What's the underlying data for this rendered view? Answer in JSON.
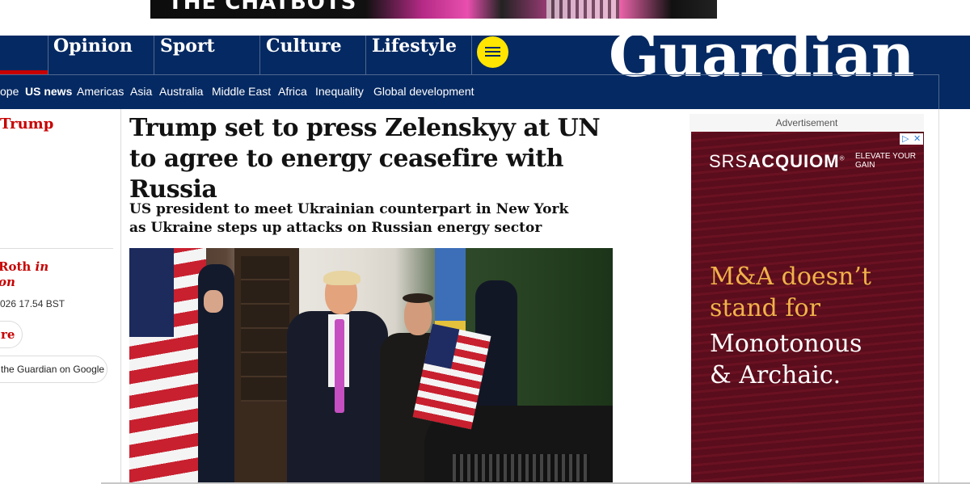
{
  "top_ad": {
    "text": "THE CHATBOTS"
  },
  "nav": {
    "pillars": [
      "Opinion",
      "Sport",
      "Culture",
      "Lifestyle"
    ],
    "logo": "Guardian",
    "subnav": [
      "ope",
      "US news",
      "Americas",
      "Asia",
      "Australia",
      "Middle East",
      "Africa",
      "Inequality",
      "Global development"
    ],
    "active_subnav": "US news"
  },
  "meta": {
    "series": "Trump",
    "byline_name": "Roth",
    "byline_in": "in",
    "byline_location": "on",
    "date": "026 17.54 BST",
    "share_label": "re",
    "google_label": "the Guardian on Google"
  },
  "article": {
    "headline": "Trump set to press Zelenskyy at UN to agree to energy ceasefire with Russia",
    "standfirst": "US president to meet Ukrainian counterpart in New York as Ukraine steps up attacks on Russian energy sector"
  },
  "ad": {
    "label": "Advertisement",
    "brand_prefix": "SRS",
    "brand_name": "ACQUIOM",
    "brand_mark": "®",
    "tagline": "ELEVATE YOUR GAIN",
    "line1": "M&A doesn’t",
    "line2": "stand for",
    "line3": "Monotonous",
    "line4": "& Archaic.",
    "choices_icon_1": "▷",
    "choices_icon_2": "✕"
  },
  "colors": {
    "nav_bg": "#052962",
    "series_red": "#c70000",
    "menu_yellow": "#ffe500",
    "ad_bg": "#5a0d1c",
    "ad_accent": "#f1b24a"
  }
}
